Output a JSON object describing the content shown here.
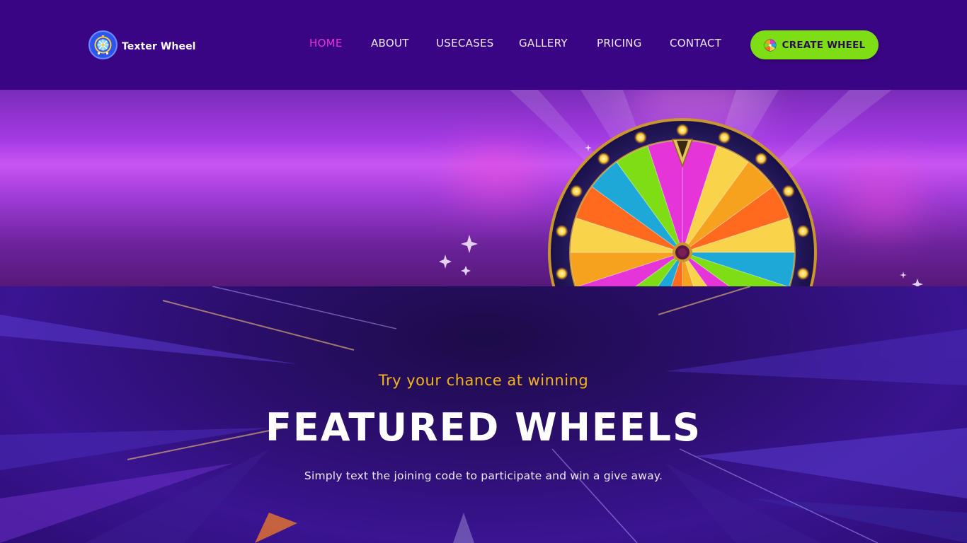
{
  "brand": {
    "name": "Texter Wheel",
    "logo_icon": "wheel-logo-icon",
    "logo_color": "#2f55f0"
  },
  "nav": {
    "items": [
      {
        "label": "HOME",
        "active": true
      },
      {
        "label": "ABOUT",
        "active": false
      },
      {
        "label": "USECASES",
        "active": false
      },
      {
        "label": "GALLERY",
        "active": false
      },
      {
        "label": "PRICING",
        "active": false
      },
      {
        "label": "CONTACT",
        "active": false
      }
    ],
    "active_color": "#e534d8"
  },
  "cta": {
    "label": "CREATE WHEEL",
    "icon": "color-wheel-icon",
    "color": "#7ede15"
  },
  "hero": {
    "image": "prize-wheel-illustration",
    "wheel_colors": [
      "#e534d8",
      "#f9d34a",
      "#f6a21e",
      "#ff6a1e",
      "#1ea8d8",
      "#7ede15"
    ]
  },
  "featured": {
    "tagline": "Try your chance at winning",
    "title": "FEATURED WHEELS",
    "subtitle": "Simply text the joining code to participate and win a give away.",
    "tagline_color": "#f6b41c"
  },
  "colors": {
    "header_bg": "#3a0585",
    "section_bg": "#2a0e6a"
  }
}
